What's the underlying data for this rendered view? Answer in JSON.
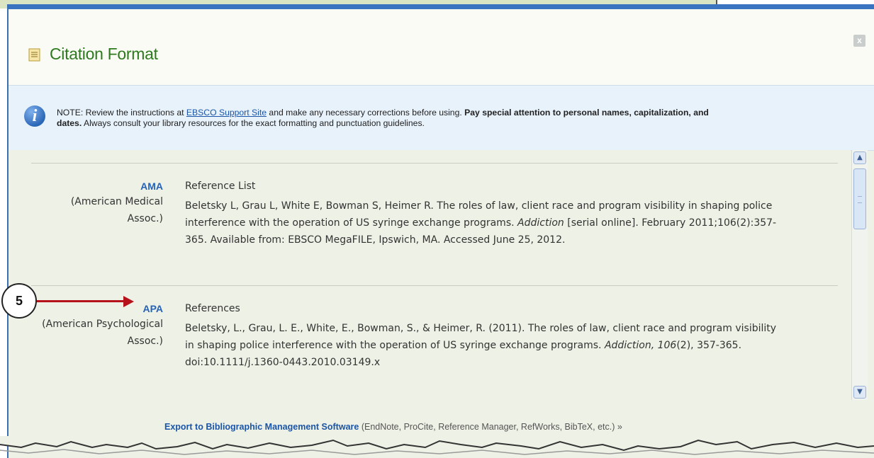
{
  "dialog": {
    "title": "Citation Format",
    "close_label": "x"
  },
  "note": {
    "prefix": "NOTE: Review the instructions at ",
    "link": "EBSCO Support Site",
    "middle": " and make any necessary corrections before using. ",
    "bold1": "Pay special attention to personal names, capitalization, and",
    "bold2": "dates.",
    "suffix": " Always consult your library resources for the exact formatting and punctuation guidelines."
  },
  "formats": [
    {
      "name": "AMA",
      "desc_line1": "(American Medical",
      "desc_line2": "Assoc.)",
      "heading": "Reference List",
      "line1": "Beletsky L, Grau L, White E, Bowman S, Heimer R. The roles of law, client race and program visibility in shaping police",
      "line2a": "interference with the operation of US syringe exchange programs. ",
      "line2_italic": "Addiction",
      "line2b": " [serial online]. February 2011;106(2):357-",
      "line3": "365. Available from: EBSCO MegaFILE, Ipswich, MA. Accessed June 25, 2012."
    },
    {
      "name": "APA",
      "desc_line1": "(American Psychological",
      "desc_line2": "Assoc.)",
      "heading": "References",
      "line1": "Beletsky, L., Grau, L. E., White, E., Bowman, S., & Heimer, R. (2011). The roles of law, client race and program visibility",
      "line2a": "in shaping police interference with the operation of US syringe exchange programs. ",
      "line2_italic": "Addiction, 106",
      "line2b": "(2), 357-365.",
      "line3": "doi:10.1111/j.1360-0443.2010.03149.x"
    }
  ],
  "export": {
    "link": "Export to Bibliographic Management Software",
    "detail": " (EndNote, ProCite, Reference Manager, RefWorks, BibTeX, etc.) »"
  },
  "callout": {
    "number": "5"
  },
  "colors": {
    "accent_blue": "#2563b8",
    "title_green": "#2d7a1e",
    "arrow_red": "#b5121b"
  }
}
